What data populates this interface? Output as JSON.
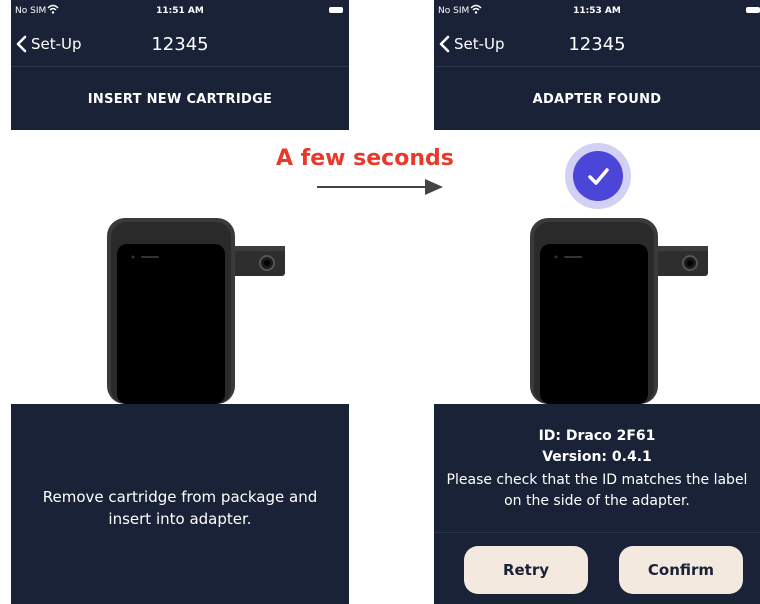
{
  "colors": {
    "navy": "#1a2238",
    "button_bg": "#f4e9df",
    "annotation": "#e8392b",
    "check_badge": "#4b45d8"
  },
  "annotation": {
    "text": "A few seconds",
    "icon": "right-arrow-icon"
  },
  "left_screen": {
    "status": {
      "carrier": "No SIM",
      "time": "11:51 AM"
    },
    "nav": {
      "back_label": "Set-Up",
      "title": "12345"
    },
    "header": "INSERT NEW CARTRIDGE",
    "instruction": "Remove cartridge from package and insert into adapter."
  },
  "right_screen": {
    "status": {
      "carrier": "No SIM",
      "time": "11:53 AM"
    },
    "nav": {
      "back_label": "Set-Up",
      "title": "12345"
    },
    "header": "ADAPTER FOUND",
    "badge_icon": "checkmark-icon",
    "adapter_id": "ID: Draco 2F61",
    "adapter_version": "Version: 0.4.1",
    "message": "Please check that the ID matches the label on the side of the adapter.",
    "buttons": {
      "retry": "Retry",
      "confirm": "Confirm"
    }
  }
}
